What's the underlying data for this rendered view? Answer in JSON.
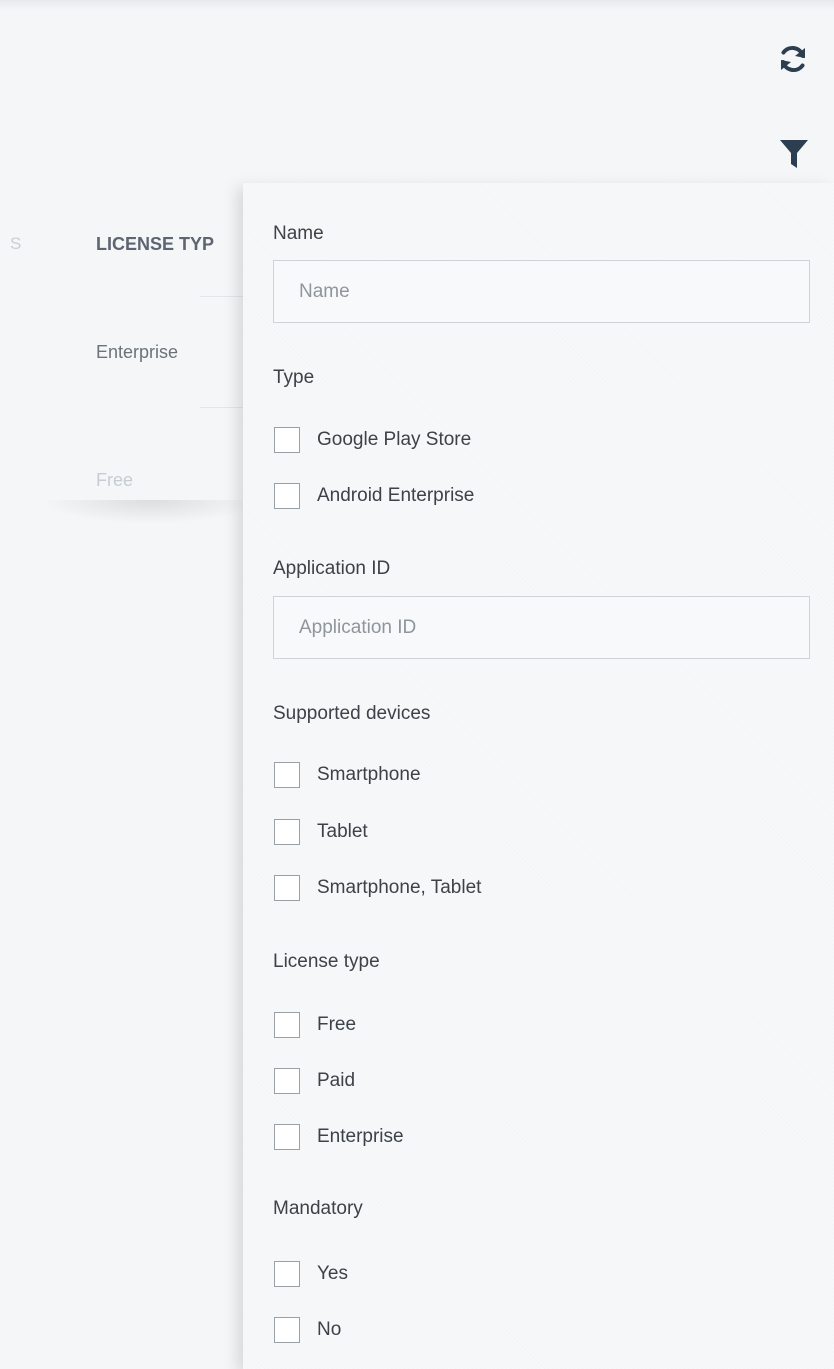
{
  "toolbar": {
    "refresh_icon": "refresh-icon",
    "filter_icon": "filter-icon",
    "accent_color": "#2d3e50"
  },
  "background_table": {
    "partial_column": "S",
    "column_header": "LICENSE TYP",
    "rows": [
      "Enterprise",
      "Free"
    ]
  },
  "filter_panel": {
    "name": {
      "label": "Name",
      "placeholder": "Name",
      "value": ""
    },
    "type": {
      "label": "Type",
      "options": [
        "Google Play Store",
        "Android Enterprise"
      ]
    },
    "application_id": {
      "label": "Application ID",
      "placeholder": "Application ID",
      "value": ""
    },
    "supported_devices": {
      "label": "Supported devices",
      "options": [
        "Smartphone",
        "Tablet",
        "Smartphone, Tablet"
      ]
    },
    "license_type": {
      "label": "License type",
      "options": [
        "Free",
        "Paid",
        "Enterprise"
      ]
    },
    "mandatory": {
      "label": "Mandatory",
      "options": [
        "Yes",
        "No"
      ]
    }
  }
}
